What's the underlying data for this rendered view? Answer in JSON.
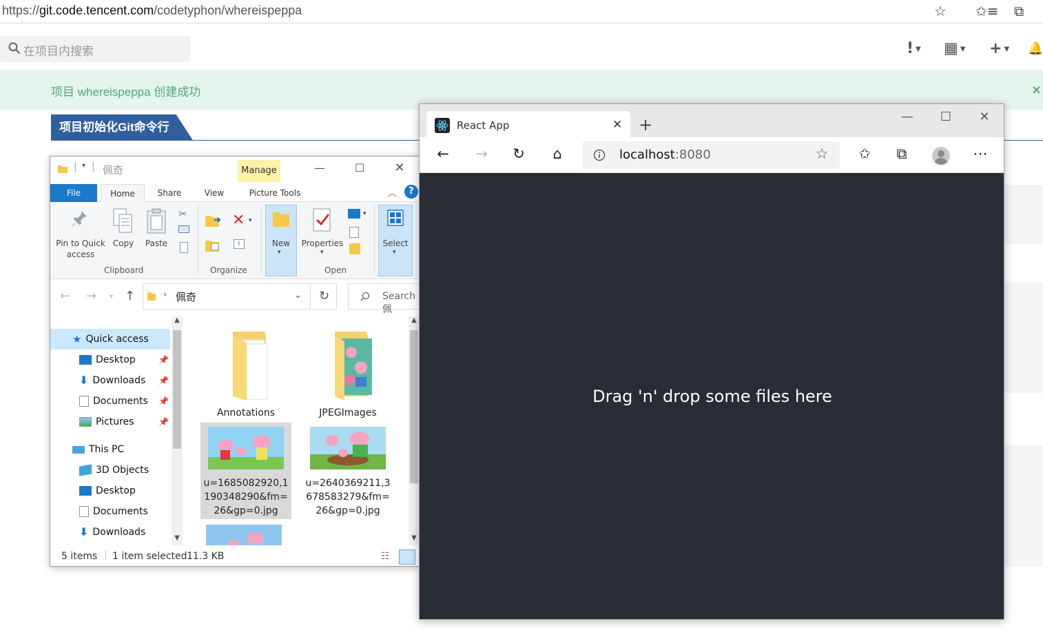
{
  "bg_browser": {
    "url_scheme": "https://",
    "url_host": "git.code.tencent.com",
    "url_path": "/codetyphon/whereispeppa",
    "search_placeholder": "在项目内搜索",
    "notice": "项目 whereispeppa 创建成功",
    "notice_close": "×",
    "section_tab": "项目初始化Git命令行",
    "header_icons": [
      "!",
      "▦",
      "+",
      "🔔"
    ]
  },
  "explorer": {
    "title": "佩奇",
    "manage": "Manage",
    "tabs": {
      "file": "File",
      "home": "Home",
      "share": "Share",
      "view": "View",
      "picture_tools": "Picture Tools"
    },
    "ribbon": {
      "pin": "Pin to Quick access",
      "copy": "Copy",
      "paste": "Paste",
      "new": "New",
      "properties": "Properties",
      "select": "Select",
      "groups": {
        "clipboard": "Clipboard",
        "organize": "Organize",
        "open": "Open"
      }
    },
    "address": "佩奇",
    "search_placeholder": "Search 佩",
    "sidebar": [
      {
        "label": "Quick access",
        "icon": "star-icon"
      },
      {
        "label": "Desktop",
        "icon": "desktop-icon",
        "pinned": true
      },
      {
        "label": "Downloads",
        "icon": "download-icon",
        "pinned": true
      },
      {
        "label": "Documents",
        "icon": "documents-icon",
        "pinned": true
      },
      {
        "label": "Pictures",
        "icon": "pictures-icon",
        "pinned": true
      },
      {
        "label": "This PC",
        "icon": "computer-icon"
      },
      {
        "label": "3D Objects",
        "icon": "cube-icon"
      },
      {
        "label": "Desktop",
        "icon": "desktop-icon"
      },
      {
        "label": "Documents",
        "icon": "documents-icon"
      },
      {
        "label": "Downloads",
        "icon": "download-icon"
      }
    ],
    "files": [
      {
        "name": "Annotations",
        "type": "folder"
      },
      {
        "name": "JPEGImages",
        "type": "folder"
      },
      {
        "name": "u=1685082920,1190348290&fm=26&gp=0.jpg",
        "line1": "u=1685082920,1",
        "line2": "190348290&fm=",
        "line3": "26&gp=0.jpg",
        "type": "image",
        "selected": true
      },
      {
        "name": "u=2640369211,3678583279&fm=26&gp=0.jpg",
        "line1": "u=2640369211,3",
        "line2": "678583279&fm=",
        "line3": "26&gp=0.jpg",
        "type": "image"
      }
    ],
    "status": {
      "count": "5 items",
      "selected": "1 item selected",
      "size": "11.3 KB"
    }
  },
  "edge": {
    "tab_title": "React App",
    "url_host": "localhost",
    "url_port": ":8080",
    "drop_text": "Drag 'n' drop some files here"
  },
  "colors": {
    "accent_blue": "#1979ca",
    "react_bg": "#282c34",
    "notice_green": "#52a77f",
    "section_blue": "#2f5f9e"
  }
}
